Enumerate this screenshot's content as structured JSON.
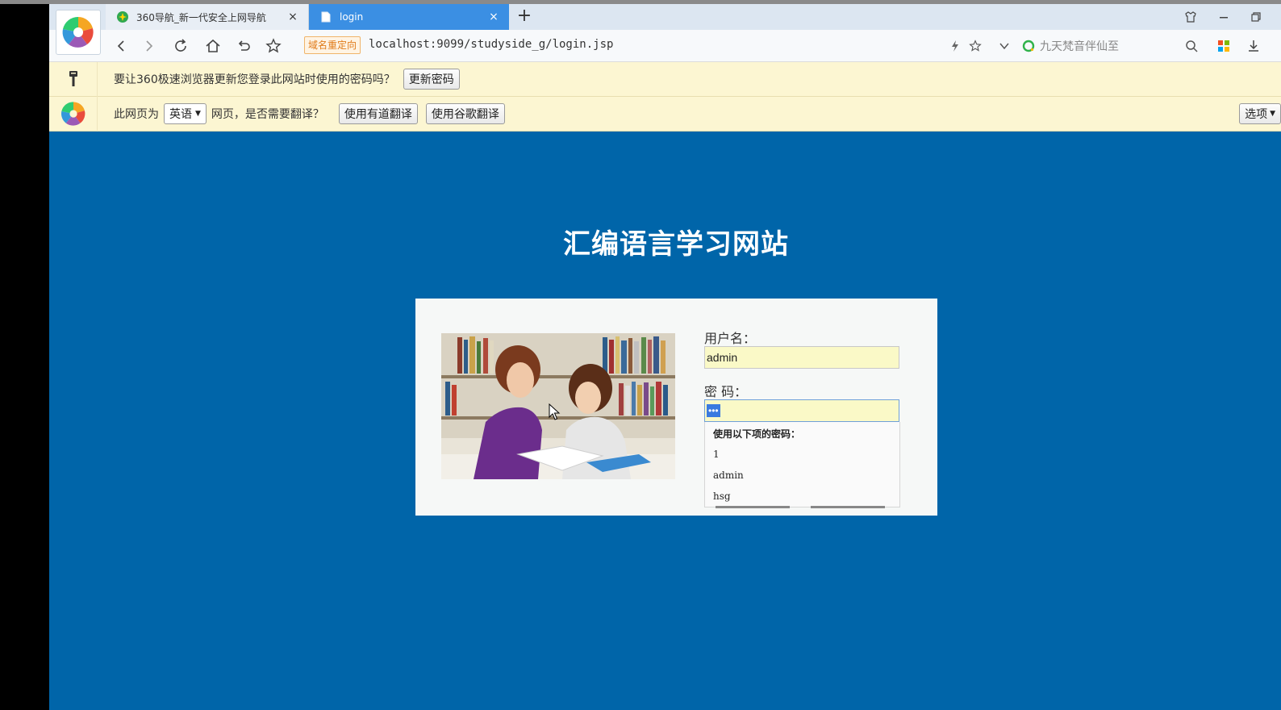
{
  "tabs": [
    {
      "title": "360导航_新一代安全上网导航",
      "close": "×"
    },
    {
      "title": "login",
      "close": "×"
    }
  ],
  "toolbar": {
    "new_tab": "+",
    "redirect_tag": "域名重定向",
    "url": "localhost:9099/studyside_g/login.jsp",
    "search_placeholder": "九天梵音伴仙至"
  },
  "password_bar": {
    "message": "要让360极速浏览器更新您登录此网站时使用的密码吗？",
    "update_button": "更新密码"
  },
  "translate_bar": {
    "prefix": "此网页为",
    "language": "英语",
    "question": "网页，是否需要翻译？",
    "youdao_button": "使用有道翻译",
    "google_button": "使用谷歌翻译",
    "options_button": "选项"
  },
  "page": {
    "title": "汇编语言学习网站",
    "username_label": "用户名：",
    "username_value": "admin",
    "password_label": "密 码：",
    "password_masked": "•••"
  },
  "autocomplete": {
    "header": "使用以下项的密码：",
    "items": [
      "1",
      "admin",
      "hsg"
    ]
  },
  "colors": {
    "page_bg": "#0065a9",
    "active_tab": "#3b8fe3",
    "infobar_bg": "#fcf6d2",
    "input_bg": "#faf9c7"
  }
}
